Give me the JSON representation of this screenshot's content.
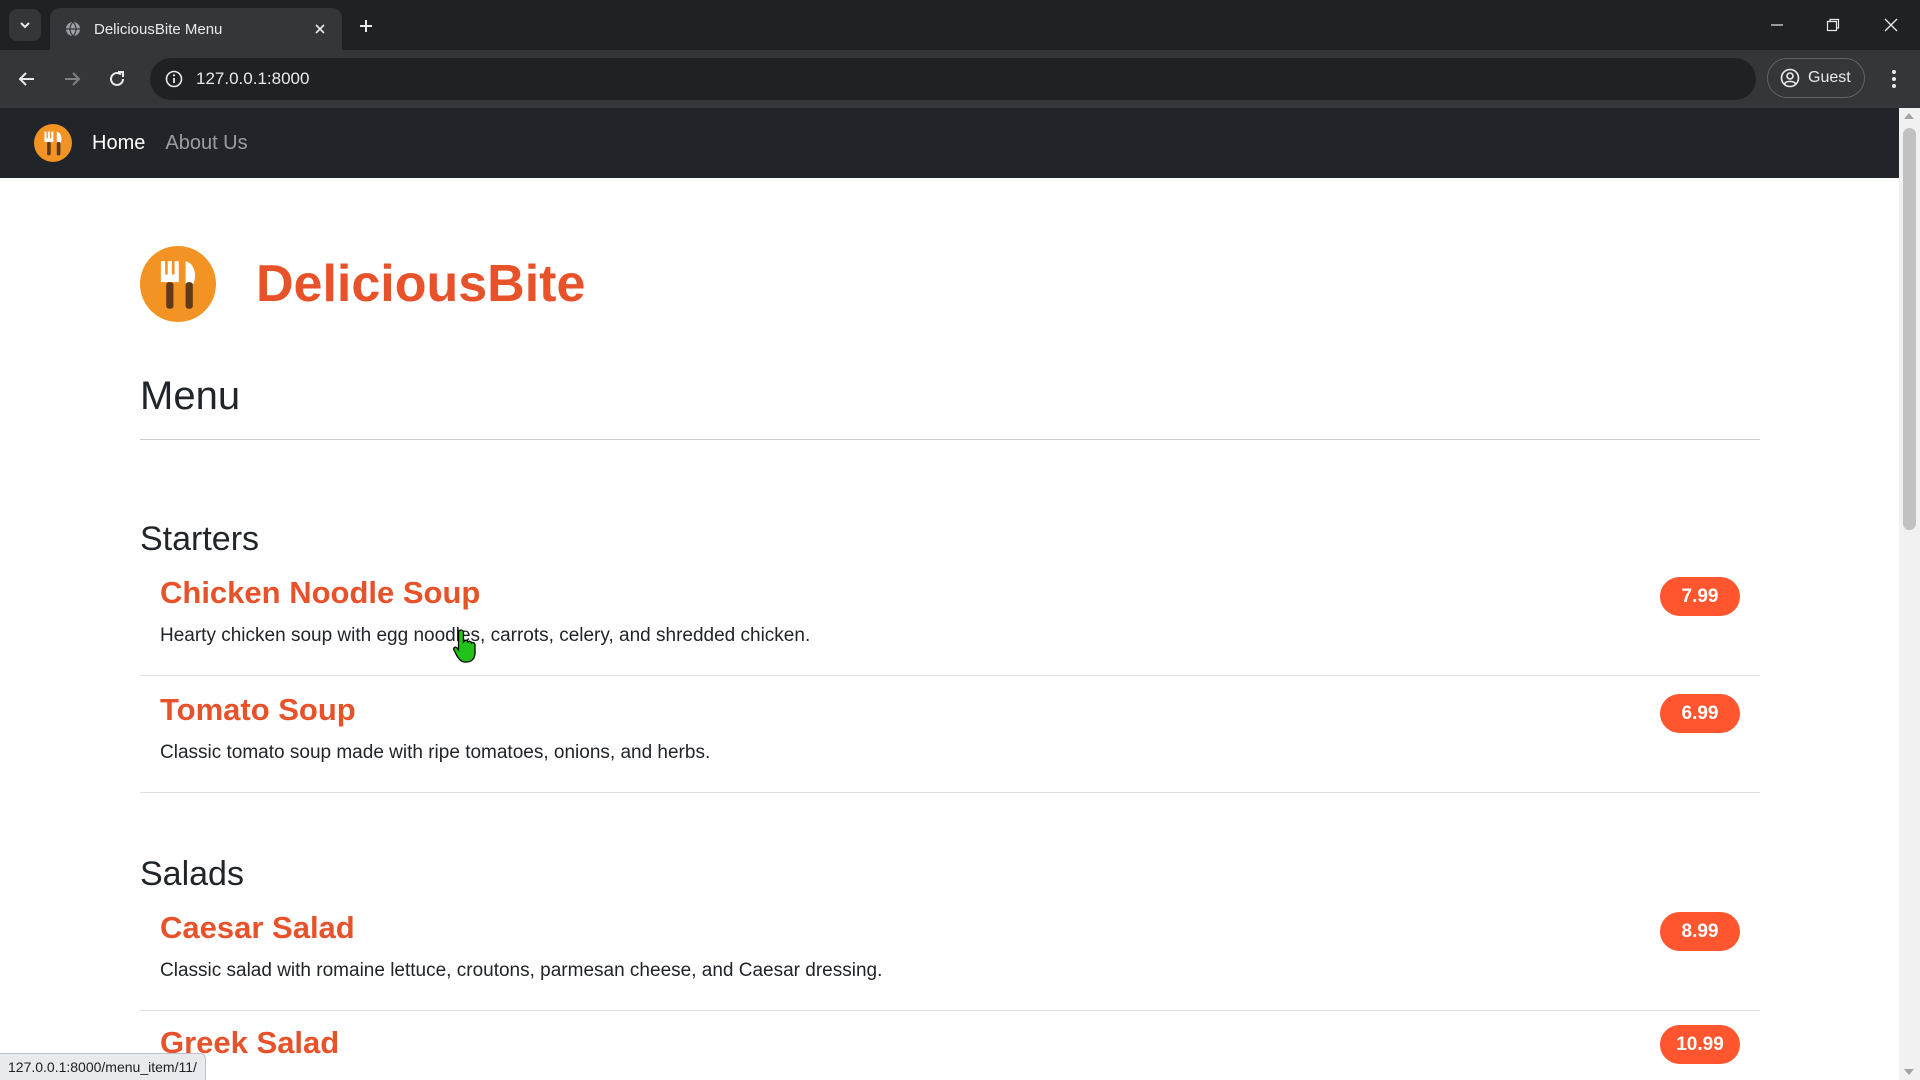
{
  "browser": {
    "tab_title": "DeliciousBite Menu",
    "url": "127.0.0.1:8000",
    "profile_label": "Guest",
    "status_url": "127.0.0.1:8000/menu_item/11/"
  },
  "navbar": {
    "links": [
      {
        "label": "Home",
        "active": true
      },
      {
        "label": "About Us",
        "active": false
      }
    ]
  },
  "brand": {
    "name": "DeliciousBite",
    "color": "#e8522a"
  },
  "menu": {
    "title": "Menu",
    "sections": [
      {
        "title": "Starters",
        "items": [
          {
            "name": "Chicken Noodle Soup",
            "description": "Hearty chicken soup with egg noodles, carrots, celery, and shredded chicken.",
            "price": "7.99"
          },
          {
            "name": "Tomato Soup",
            "description": "Classic tomato soup made with ripe tomatoes, onions, and herbs.",
            "price": "6.99"
          }
        ]
      },
      {
        "title": "Salads",
        "items": [
          {
            "name": "Caesar Salad",
            "description": "Classic salad with romaine lettuce, croutons, parmesan cheese, and Caesar dressing.",
            "price": "8.99"
          },
          {
            "name": "Greek Salad",
            "description": "",
            "price": "10.99"
          }
        ]
      }
    ]
  },
  "colors": {
    "price_badge": "#ff5630",
    "navbar_bg": "#212529"
  }
}
